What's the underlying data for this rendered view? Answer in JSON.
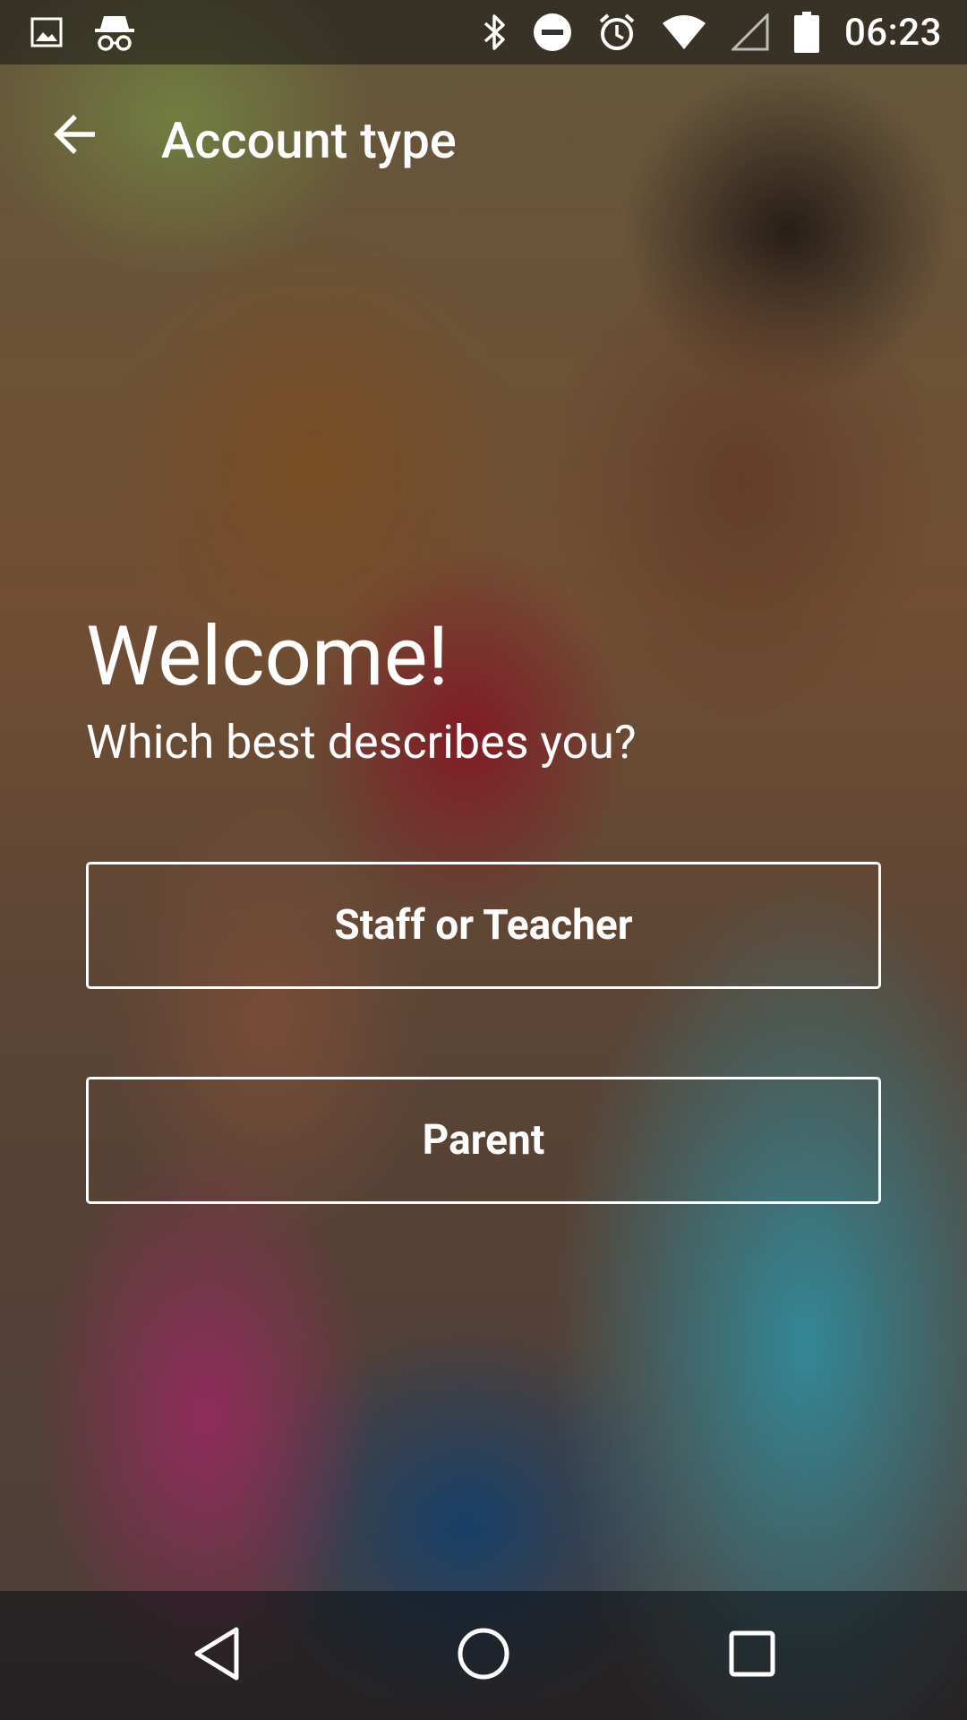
{
  "status_bar": {
    "time": "06:23",
    "left_icons": [
      "image-icon",
      "incognito-icon"
    ],
    "right_icons": [
      "bluetooth-icon",
      "do-not-disturb-icon",
      "alarm-icon",
      "wifi-icon",
      "cell-signal-icon",
      "battery-icon"
    ]
  },
  "app_bar": {
    "title": "Account type",
    "back_icon": "arrow-back-icon"
  },
  "main": {
    "heading": "Welcome!",
    "subheading": "Which best describes you?",
    "options": [
      {
        "label": "Staff or Teacher"
      },
      {
        "label": "Parent"
      }
    ]
  },
  "nav_bar": {
    "icons": [
      "nav-back-icon",
      "nav-home-icon",
      "nav-recents-icon"
    ]
  },
  "colors": {
    "text": "#ffffff",
    "button_border": "#ffffff",
    "status_bar_bg": "rgba(20,20,20,0.55)",
    "nav_bar_bg": "rgba(10,15,20,0.55)"
  }
}
